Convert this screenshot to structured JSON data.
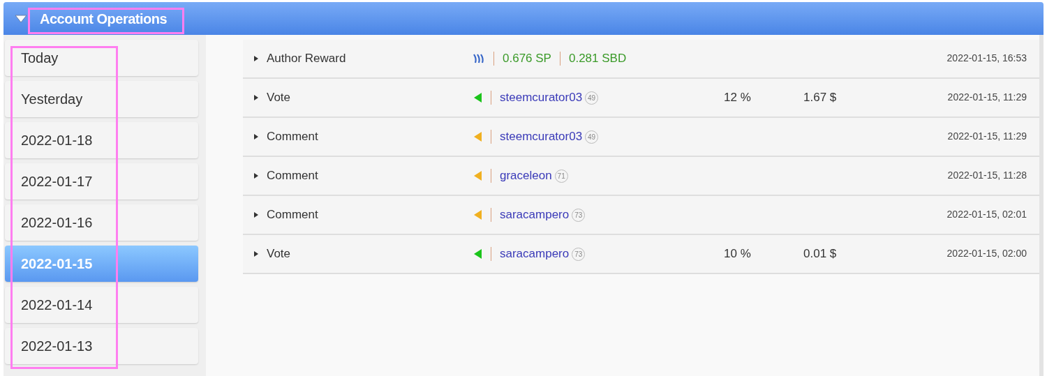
{
  "panel": {
    "title": "Account Operations",
    "expanded": true
  },
  "dates": [
    {
      "label": "Today",
      "selected": false
    },
    {
      "label": "Yesterday",
      "selected": false
    },
    {
      "label": "2022-01-18",
      "selected": false
    },
    {
      "label": "2022-01-17",
      "selected": false
    },
    {
      "label": "2022-01-16",
      "selected": false
    },
    {
      "label": "2022-01-15",
      "selected": true
    },
    {
      "label": "2022-01-14",
      "selected": false
    },
    {
      "label": "2022-01-13",
      "selected": false
    }
  ],
  "operations": [
    {
      "kind": "reward",
      "type": "Author Reward",
      "amounts": [
        "0.676 SP",
        "0.281 SBD"
      ],
      "time": "2022-01-15, 16:53"
    },
    {
      "kind": "vote",
      "type": "Vote",
      "account": "steemcurator03",
      "reputation": "49",
      "percent": "12 %",
      "value": "1.67 $",
      "time": "2022-01-15, 11:29"
    },
    {
      "kind": "comment",
      "type": "Comment",
      "account": "steemcurator03",
      "reputation": "49",
      "time": "2022-01-15, 11:29"
    },
    {
      "kind": "comment",
      "type": "Comment",
      "account": "graceleon",
      "reputation": "71",
      "time": "2022-01-15, 11:28"
    },
    {
      "kind": "comment",
      "type": "Comment",
      "account": "saracampero",
      "reputation": "73",
      "time": "2022-01-15, 02:01"
    },
    {
      "kind": "vote",
      "type": "Vote",
      "account": "saracampero",
      "reputation": "73",
      "percent": "10 %",
      "value": "0.01 $",
      "time": "2022-01-15, 02:00"
    }
  ]
}
